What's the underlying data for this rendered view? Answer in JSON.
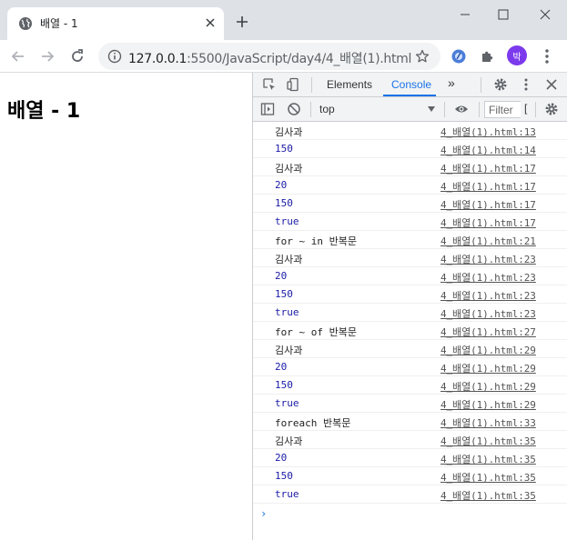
{
  "browser": {
    "tab_title": "배열 - 1",
    "url_host": "127.0.0.1",
    "url_port": ":5500",
    "url_path": "/JavaScript/day4/4_배열(1).html",
    "profile_initial": "박"
  },
  "page": {
    "heading": "배열 - 1"
  },
  "devtools": {
    "tabs": [
      {
        "label": "Elements"
      },
      {
        "label": "Console"
      }
    ],
    "overflow_label": "»",
    "context": "top",
    "filter_placeholder": "Filter",
    "filter_more": "[",
    "prompt": "›",
    "logs": [
      {
        "msg": "김사과",
        "src": "4_배열(1).html:13",
        "kind": "str"
      },
      {
        "msg": "150",
        "src": "4_배열(1).html:14",
        "kind": "num"
      },
      {
        "msg": "김사과",
        "src": "4_배열(1).html:17",
        "kind": "str"
      },
      {
        "msg": "20",
        "src": "4_배열(1).html:17",
        "kind": "num"
      },
      {
        "msg": "150",
        "src": "4_배열(1).html:17",
        "kind": "num"
      },
      {
        "msg": "true",
        "src": "4_배열(1).html:17",
        "kind": "bool"
      },
      {
        "msg": "for ~ in 반복문",
        "src": "4_배열(1).html:21",
        "kind": "str"
      },
      {
        "msg": "김사과",
        "src": "4_배열(1).html:23",
        "kind": "str"
      },
      {
        "msg": "20",
        "src": "4_배열(1).html:23",
        "kind": "num"
      },
      {
        "msg": "150",
        "src": "4_배열(1).html:23",
        "kind": "num"
      },
      {
        "msg": "true",
        "src": "4_배열(1).html:23",
        "kind": "bool"
      },
      {
        "msg": "for ~ of 반복문",
        "src": "4_배열(1).html:27",
        "kind": "str"
      },
      {
        "msg": "김사과",
        "src": "4_배열(1).html:29",
        "kind": "str"
      },
      {
        "msg": "20",
        "src": "4_배열(1).html:29",
        "kind": "num"
      },
      {
        "msg": "150",
        "src": "4_배열(1).html:29",
        "kind": "num"
      },
      {
        "msg": "true",
        "src": "4_배열(1).html:29",
        "kind": "bool"
      },
      {
        "msg": "foreach 반복문",
        "src": "4_배열(1).html:33",
        "kind": "str"
      },
      {
        "msg": "김사과",
        "src": "4_배열(1).html:35",
        "kind": "str"
      },
      {
        "msg": "20",
        "src": "4_배열(1).html:35",
        "kind": "num"
      },
      {
        "msg": "150",
        "src": "4_배열(1).html:35",
        "kind": "num"
      },
      {
        "msg": "true",
        "src": "4_배열(1).html:35",
        "kind": "bool"
      }
    ]
  }
}
